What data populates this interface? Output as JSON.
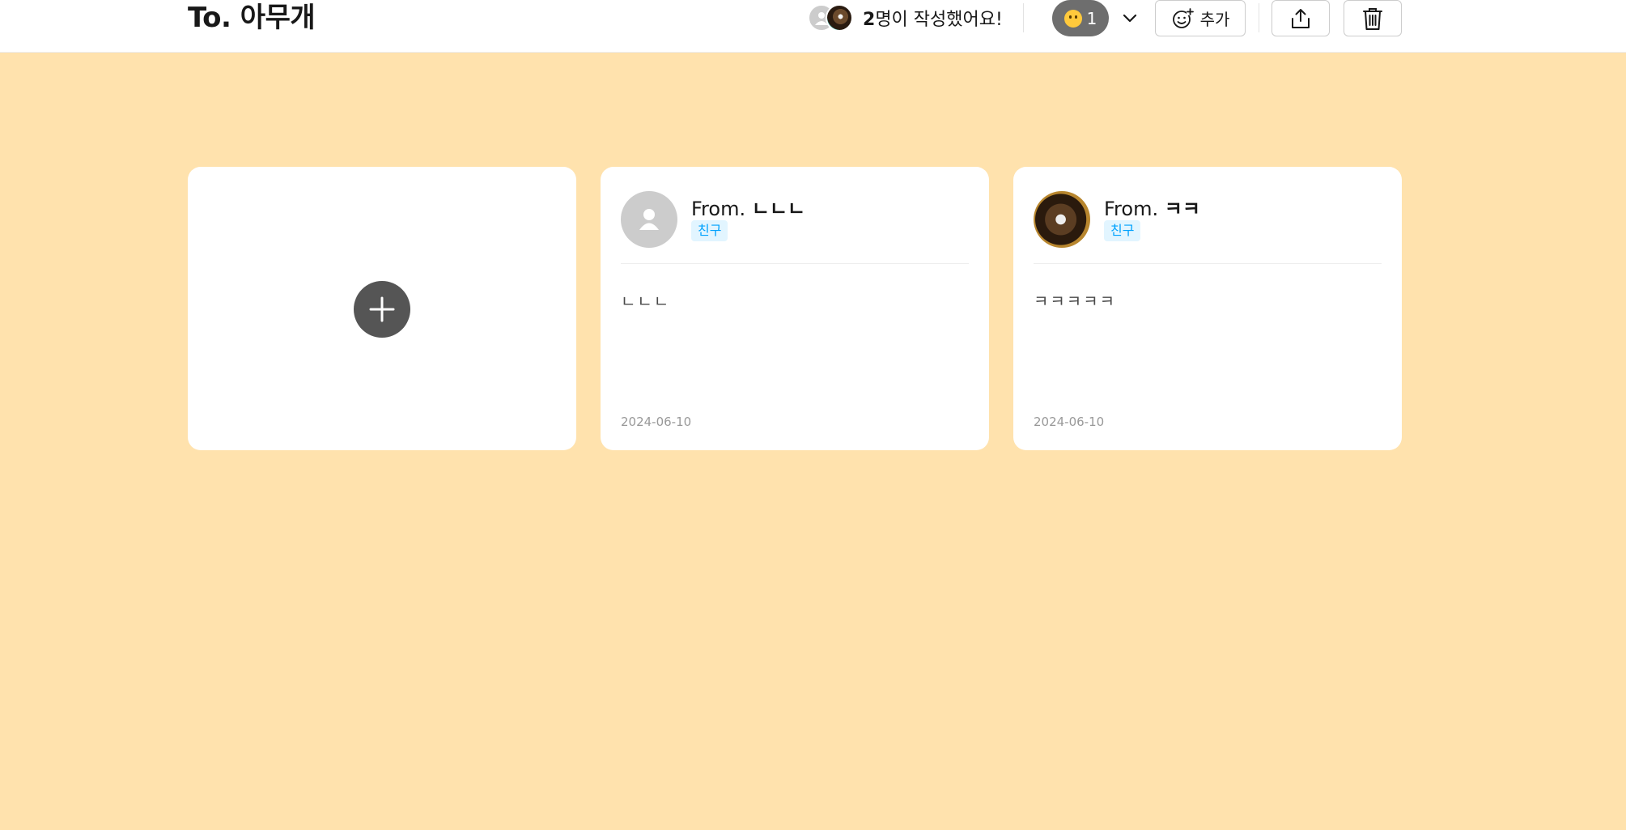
{
  "header": {
    "title": "To. 아무개",
    "writers": {
      "count": "2",
      "suffix": "명이 작성했어요!",
      "avatars": [
        "default-avatar",
        "photo-avatar"
      ]
    },
    "reaction": {
      "emoji_icon": "smiling-face-icon",
      "count": "1"
    },
    "add_reaction_label": "추가",
    "share_icon": "share-icon",
    "delete_icon": "trash-icon"
  },
  "colors": {
    "background": "#ffe2ad",
    "badge": "#6e6e6e",
    "tag_bg": "#e2f5ff",
    "tag_text": "#00a2fe",
    "plus_button": "#555555"
  },
  "cards": [
    {
      "from_prefix": "From.",
      "sender": "ㄴㄴㄴ",
      "relationship": "친구",
      "content": "ㄴㄴㄴ",
      "date": "2024-06-10",
      "avatar": "default-avatar"
    },
    {
      "from_prefix": "From.",
      "sender": "ㅋㅋ",
      "relationship": "친구",
      "content": "ㅋㅋㅋㅋㅋ",
      "date": "2024-06-10",
      "avatar": "photo-avatar"
    }
  ]
}
